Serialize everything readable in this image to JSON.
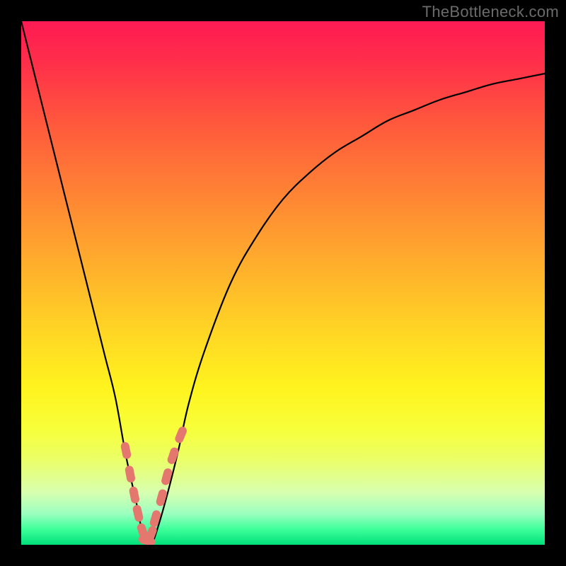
{
  "watermark": "TheBottleneck.com",
  "colors": {
    "frame": "#000000",
    "curve": "#000000",
    "marker": "#e4786f",
    "gradient_top": "#ff1a53",
    "gradient_bottom": "#00e07a"
  },
  "chart_data": {
    "type": "line",
    "title": "",
    "xlabel": "",
    "ylabel": "",
    "xlim": [
      0,
      100
    ],
    "ylim": [
      0,
      100
    ],
    "grid": false,
    "legend": false,
    "note": "Axes untitled/unticked in source image; x normalized 0-100 left→right, y is bottleneck % 0-100 bottom→top (green=0, red=100).",
    "series": [
      {
        "name": "bottleneck-curve",
        "x": [
          0,
          2,
          4,
          6,
          8,
          10,
          12,
          14,
          16,
          18,
          20,
          22,
          23,
          24,
          25,
          26,
          28,
          30,
          32,
          35,
          40,
          45,
          50,
          55,
          60,
          65,
          70,
          75,
          80,
          85,
          90,
          95,
          100
        ],
        "y": [
          100,
          92,
          84,
          76,
          68,
          60,
          52,
          44,
          36,
          28,
          17,
          8,
          3,
          0.5,
          0.5,
          3,
          10,
          18,
          27,
          37,
          50,
          59,
          66,
          71,
          75,
          78,
          81,
          83,
          85,
          86.5,
          88,
          89,
          90
        ]
      }
    ],
    "markers": {
      "name": "highlighted-points",
      "shape": "pill",
      "x": [
        20.0,
        20.8,
        21.6,
        22.3,
        23.2,
        24.0,
        24.8,
        25.6,
        26.8,
        27.8,
        29.0,
        30.5
      ],
      "y": [
        18.0,
        13.5,
        9.5,
        6.0,
        2.5,
        0.8,
        2.0,
        5.0,
        9.0,
        13.0,
        17.0,
        21.0
      ]
    }
  }
}
